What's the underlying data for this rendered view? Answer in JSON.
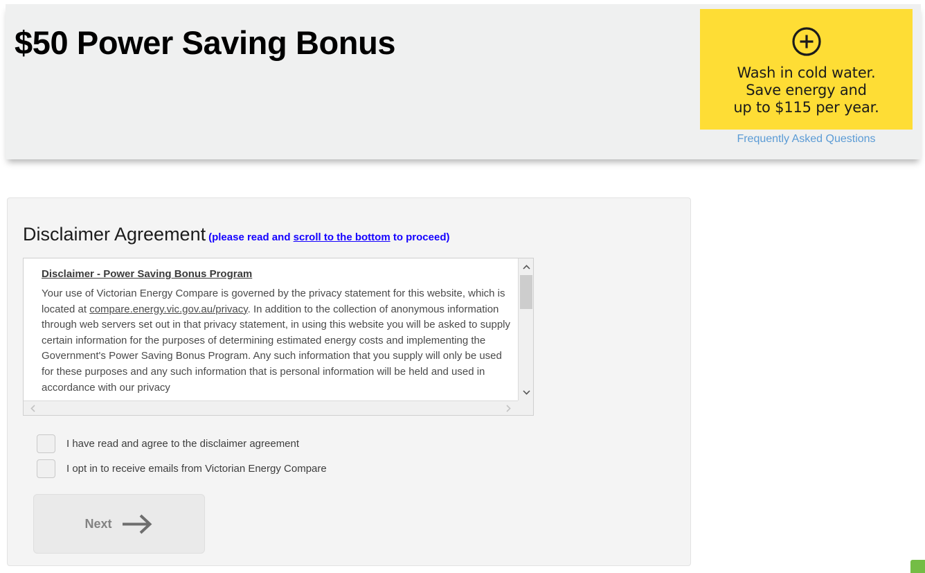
{
  "header": {
    "title": "$50 Power Saving Bonus",
    "promo": {
      "icon": "plus-circle-icon",
      "line1": "Wash in cold water.",
      "line2": "Save energy and",
      "line3": "up to $115 per year.",
      "background_color": "#FEDD35"
    },
    "faq_link": "Frequently Asked Questions",
    "faq_link_color": "#5B9BD5"
  },
  "main": {
    "heading": {
      "title": "Disclaimer Agreement",
      "note_prefix": "(please read and ",
      "note_link": "scroll to the bottom",
      "note_suffix": " to proceed)",
      "note_color": "#1400FF"
    },
    "disclaimer": {
      "title": "Disclaimer - Power Saving Bonus Program",
      "body_part1": "Your use of Victorian Energy Compare is governed by the privacy statement for this website, which is located at ",
      "body_link": "compare.energy.vic.gov.au/privacy",
      "body_part2": ". In addition to the collection of anonymous information through web servers set out in that privacy statement, in using this website you will be asked to supply certain information for the purposes of determining estimated energy costs and implementing the Government's Power Saving Bonus Program. Any such information that you supply will only be used for these purposes and any such information that is personal information will be held and used in accordance with our privacy",
      "scroll_up_icon": "chevron-up-icon",
      "scroll_down_icon": "chevron-down-icon",
      "scroll_left_icon": "chevron-left-icon",
      "scroll_right_icon": "chevron-right-icon"
    },
    "checkboxes": [
      {
        "label": "I have read and agree to the disclaimer agreement",
        "checked": false
      },
      {
        "label": "I opt in to receive emails from Victorian Energy Compare",
        "checked": false
      }
    ],
    "next_button": {
      "label": "Next",
      "icon": "arrow-right-icon",
      "enabled": false
    }
  },
  "chat_widget": {
    "name": "chat-launcher",
    "color": "#74BD45"
  }
}
